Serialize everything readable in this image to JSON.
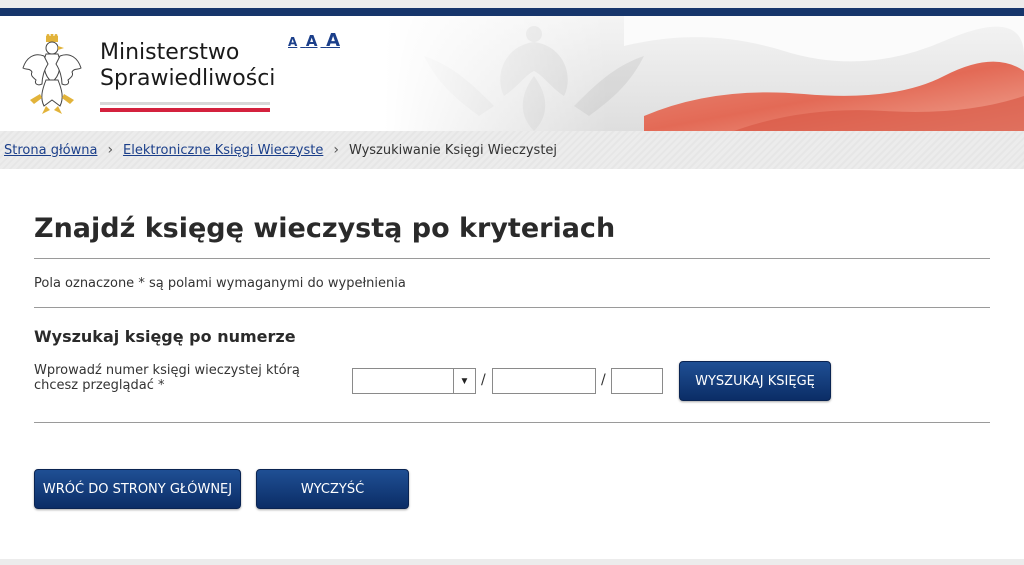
{
  "header": {
    "ministry_line1": "Ministerstwo",
    "ministry_line2": "Sprawiedliwości",
    "font_size_small": "A",
    "font_size_medium": "A",
    "font_size_large": "A",
    "eagle_icon": "polish-eagle-emblem",
    "colors": {
      "topbar": "#16356b",
      "flag_red": "#d4213d"
    }
  },
  "breadcrumb": {
    "home": "Strona główna",
    "section": "Elektroniczne Księgi Wieczyste",
    "current": "Wyszukiwanie Księgi Wieczystej",
    "separator_icon": "chevron-right-icon"
  },
  "main": {
    "title": "Znajdź księgę wieczystą po kryteriach",
    "required_note": "Pola oznaczone * są polami wymaganymi do wypełnienia",
    "subtitle": "Wyszukaj księgę po numerze",
    "field_label": "Wprowadź numer księgi wieczystej którą chcesz przeglądać *",
    "court_code_value": "",
    "number_value": "",
    "check_digit_value": "",
    "slash": "/",
    "search_button": "WYSZUKAJ KSIĘGĘ",
    "back_button": "WRÓĆ DO STRONY GŁÓWNEJ",
    "clear_button": "WYCZYŚĆ",
    "colors": {
      "button": "#0b2d66",
      "link": "#1b3f8a"
    }
  }
}
